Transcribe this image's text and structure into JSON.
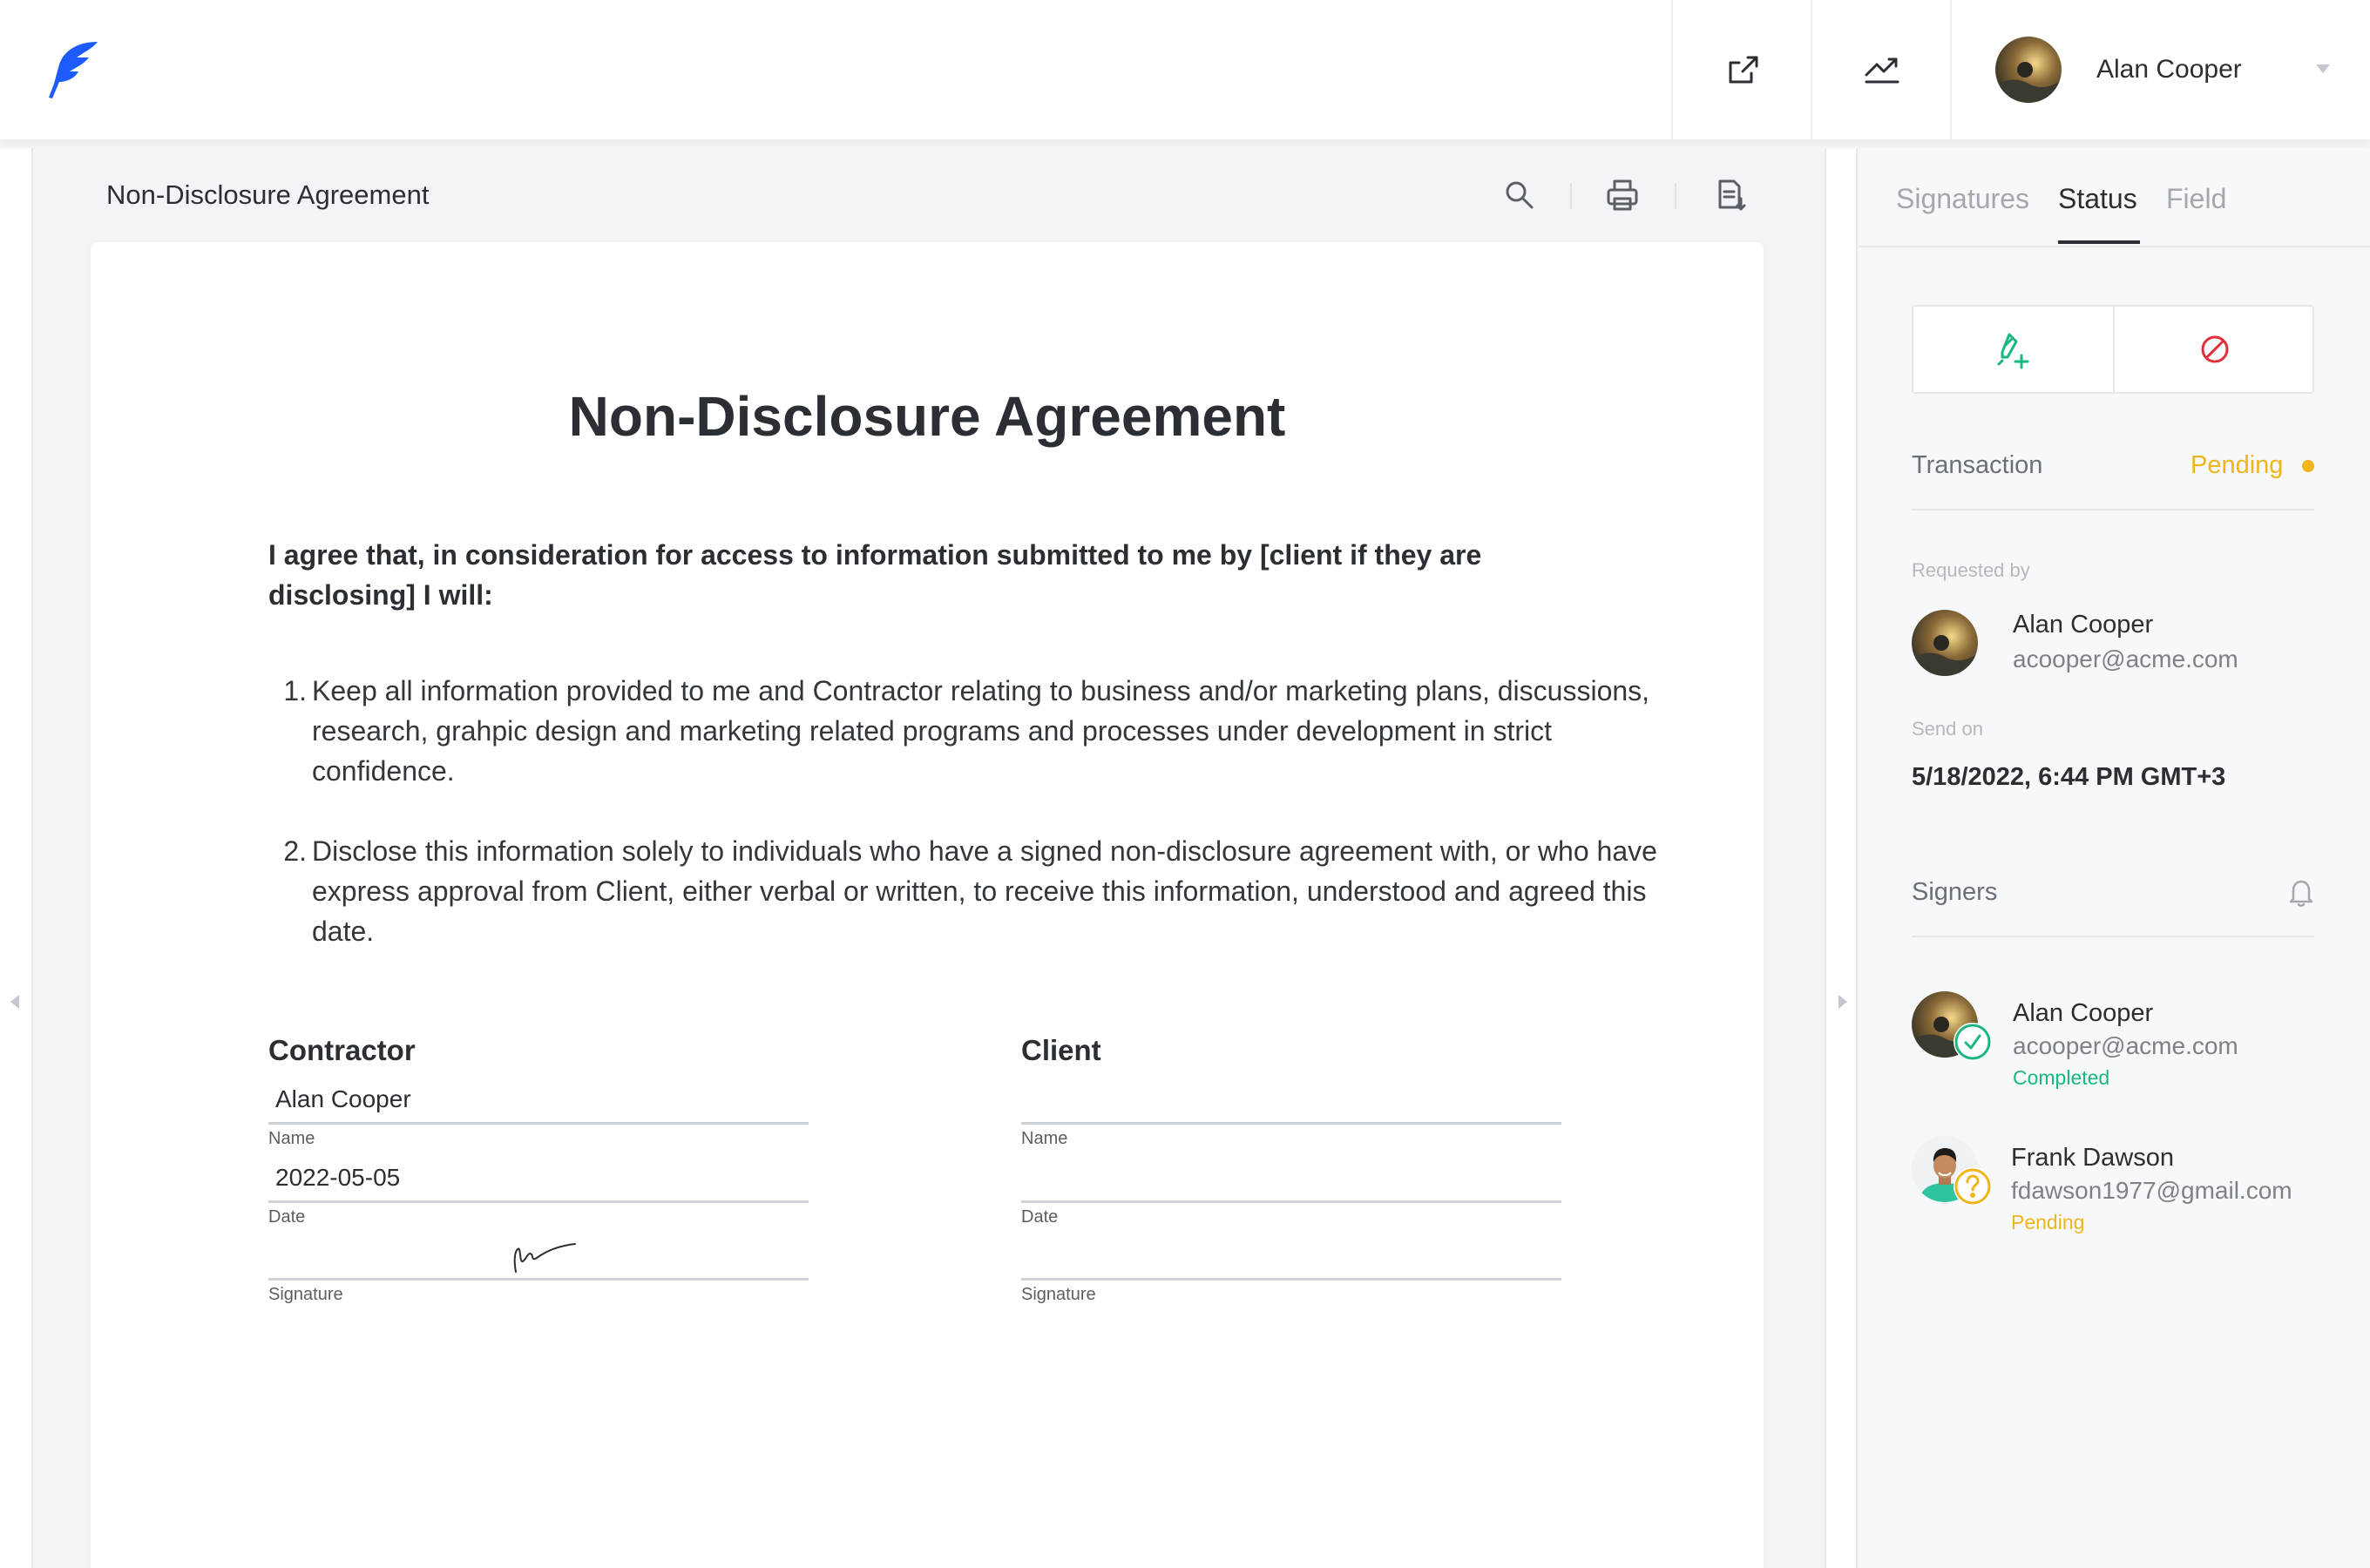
{
  "colors": {
    "brand": "#1e5bff",
    "accent_green": "#1ab77f",
    "pending": "#f0b51b",
    "danger": "#e0303a",
    "text": "#2b2f33"
  },
  "header": {
    "logo_icon": "feather-logo-icon",
    "actions": [
      {
        "icon": "share-icon"
      },
      {
        "icon": "analytics-icon"
      }
    ],
    "user": {
      "name": "Alan Cooper",
      "dropdown_icon": "caret-down-icon"
    }
  },
  "document": {
    "title": "Non-Disclosure Agreement",
    "tools": [
      {
        "icon": "search-icon"
      },
      {
        "icon": "print-icon"
      },
      {
        "icon": "document-download-icon"
      }
    ],
    "heading": "Non-Disclosure Agreement",
    "intro": "I agree that, in consideration for access to information submitted to me by [client if they are disclosing] I will:",
    "clauses": [
      {
        "num": "1.",
        "text": "Keep all information provided to me and Contractor relating to business and/or marketing plans, discussions, research, grahpic design and marketing related programs and processes under development in strict confidence."
      },
      {
        "num": "2.",
        "text": "Disclose this information solely to individuals who have a signed non-disclosure agreement with, or who have express approval from Client, either verbal or written, to receive this information, understood and agreed this date."
      }
    ],
    "contractor": {
      "heading": "Contractor",
      "name_value": "Alan Cooper",
      "name_label": "Name",
      "date_value": "2022-05-05",
      "date_label": "Date",
      "signature_label": "Signature"
    },
    "client": {
      "heading": "Client",
      "name_value": "",
      "name_label": "Name",
      "date_value": "",
      "date_label": "Date",
      "signature_label": "Signature"
    }
  },
  "panel": {
    "tabs": [
      {
        "label": "Signatures",
        "active": false
      },
      {
        "label": "Status",
        "active": true
      },
      {
        "label": "Field",
        "active": false
      }
    ],
    "actions": [
      {
        "icon": "add-signer-pen-icon"
      },
      {
        "icon": "cancel-icon"
      }
    ],
    "transaction_label": "Transaction",
    "transaction_status": "Pending",
    "requested_by_label": "Requested by",
    "requester": {
      "name": "Alan Cooper",
      "email": "acooper@acme.com"
    },
    "send_on_label": "Send on",
    "send_on_value": "5/18/2022, 6:44 PM GMT+3",
    "signers_label": "Signers",
    "signers_icon": "bell-icon",
    "signers": [
      {
        "name": "Alan Cooper",
        "email": "acooper@acme.com",
        "status": "Completed",
        "badge_icon": "check-badge-icon"
      },
      {
        "name": "Frank Dawson",
        "email": "fdawson1977@gmail.com",
        "status": "Pending",
        "badge_icon": "question-badge-icon"
      }
    ]
  }
}
